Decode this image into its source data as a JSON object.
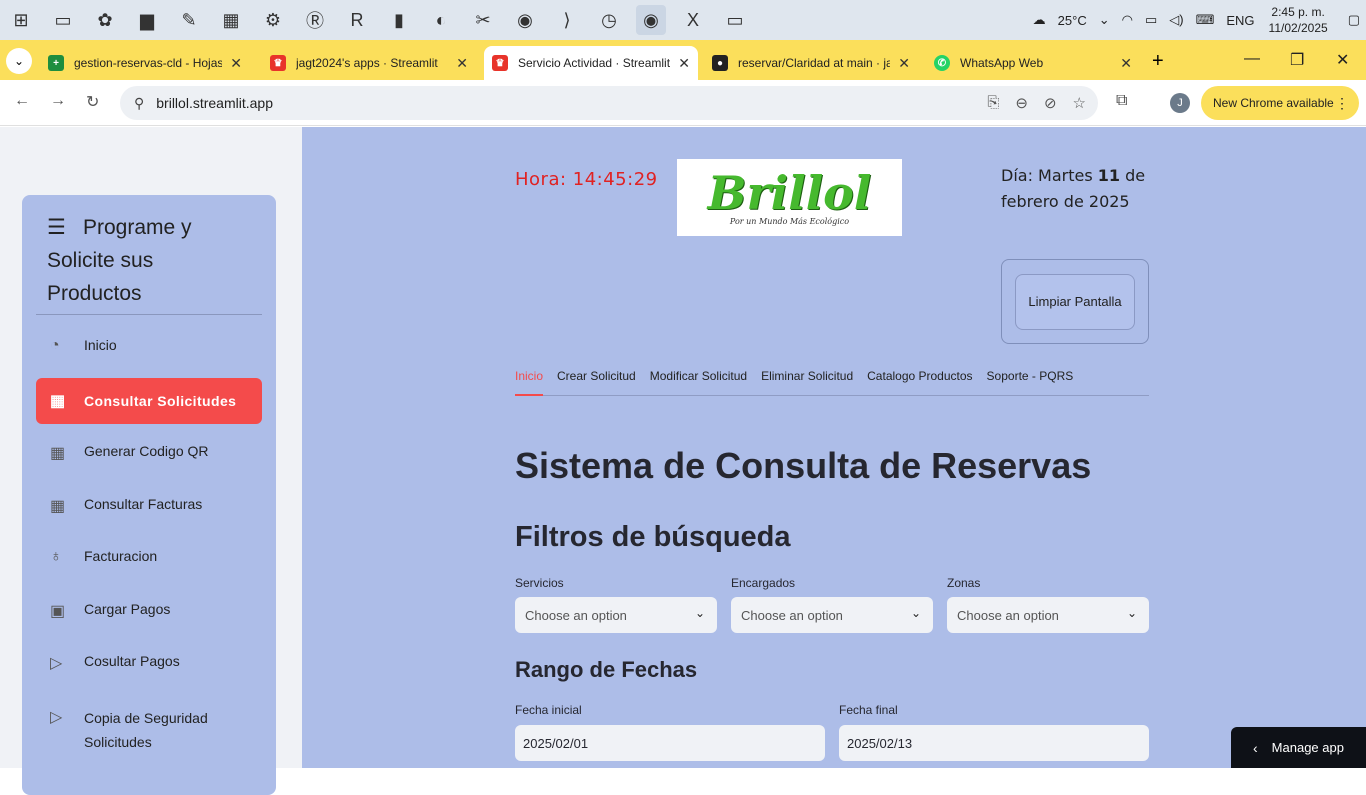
{
  "taskbar": {
    "temperature": "25°C",
    "language": "ENG",
    "time": "2:45 p. m.",
    "date": "11/02/2025"
  },
  "browser": {
    "tabs": [
      {
        "title": "gestion-reservas-cld - Hojas",
        "color": "#1e8e3e"
      },
      {
        "title": "jagt2024's apps · Streamlit",
        "color": "#e8332a"
      },
      {
        "title": "Servicio Actividad · Streamlit",
        "color": "#e8332a"
      },
      {
        "title": "reservar/Claridad at main · ja",
        "color": "#222222"
      },
      {
        "title": "WhatsApp Web",
        "color": "#25d366"
      }
    ],
    "url": "brillol.streamlit.app",
    "profile_initial": "J",
    "update_label": "New Chrome available"
  },
  "sidebar": {
    "title": "Programe y Solicite sus Productos",
    "items": [
      {
        "label": "Inicio",
        "icon": "toggle-icon"
      },
      {
        "label": "Consultar Solicitudes",
        "icon": "calendar-icon"
      },
      {
        "label": "Generar Codigo QR",
        "icon": "calendar-icon"
      },
      {
        "label": "Consultar Facturas",
        "icon": "calendar-icon"
      },
      {
        "label": "Facturacion",
        "icon": "award-icon"
      },
      {
        "label": "Cargar Pagos",
        "icon": "clipboard-icon"
      },
      {
        "label": "Cosultar Pagos",
        "icon": "play-icon"
      },
      {
        "label": "Copia de Seguridad Solicitudes",
        "icon": "play-icon"
      }
    ],
    "selected_index": 1
  },
  "header": {
    "hora": "Hora: 14:45:29",
    "logo_text": "Brillol",
    "logo_tagline": "Por un Mundo Más Ecológico",
    "dia_prefix": "Día: Martes ",
    "dia_day": "11",
    "dia_suffix": " de febrero de 2025",
    "limpiar_label": "Limpiar Pantalla"
  },
  "nav_tabs": [
    "Inicio",
    "Crear Solicitud",
    "Modificar Solicitud",
    "Eliminar Solicitud",
    "Catalogo Productos",
    "Soporte - PQRS"
  ],
  "content": {
    "title": "Sistema de Consulta de Reservas",
    "filters_title": "Filtros de búsqueda",
    "filters": [
      {
        "label": "Servicios",
        "placeholder": "Choose an option"
      },
      {
        "label": "Encargados",
        "placeholder": "Choose an option"
      },
      {
        "label": "Zonas",
        "placeholder": "Choose an option"
      }
    ],
    "date_range_title": "Rango de Fechas",
    "fecha_inicial_label": "Fecha inicial",
    "fecha_inicial_value": "2025/02/01",
    "fecha_final_label": "Fecha final",
    "fecha_final_value": "2025/02/13"
  },
  "manage_app": "Manage app"
}
